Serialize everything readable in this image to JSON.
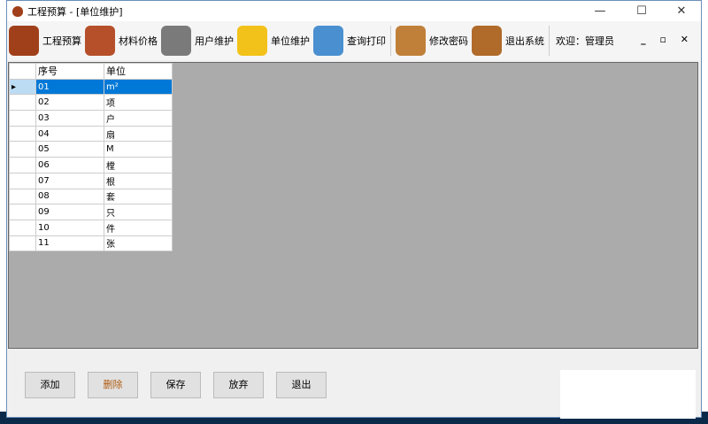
{
  "window": {
    "title": "工程预算 - [单位维护]",
    "minimize": "—",
    "maximize": "☐",
    "close": "✕"
  },
  "toolbar": {
    "items": [
      {
        "label": "工程预算",
        "icon": "money-bag-icon",
        "color": "#a0401a"
      },
      {
        "label": "材料价格",
        "icon": "box-icon",
        "color": "#b5502a"
      },
      {
        "label": "用户维护",
        "icon": "user-icon",
        "color": "#7a7a7a"
      },
      {
        "label": "单位维护",
        "icon": "ruler-icon",
        "color": "#f2c21a"
      },
      {
        "label": "查询打印",
        "icon": "report-icon",
        "color": "#4a90d0"
      },
      {
        "label": "修改密码",
        "icon": "user-lock-icon",
        "color": "#c0803a"
      },
      {
        "label": "退出系统",
        "icon": "exit-door-icon",
        "color": "#b06a2a"
      }
    ],
    "welcome": "欢迎：管理员",
    "mdi_controls": "_ ▫ ✕"
  },
  "grid": {
    "columns": [
      "序号",
      "单位"
    ],
    "rows": [
      [
        "01",
        "m²"
      ],
      [
        "02",
        "项"
      ],
      [
        "03",
        "户"
      ],
      [
        "04",
        "扇"
      ],
      [
        "05",
        "M"
      ],
      [
        "06",
        "樘"
      ],
      [
        "07",
        "根"
      ],
      [
        "08",
        "套"
      ],
      [
        "09",
        "只"
      ],
      [
        "10",
        "件"
      ],
      [
        "11",
        "张"
      ]
    ],
    "selected_row": 0
  },
  "buttons": {
    "add": "添加",
    "delete": "删除",
    "save": "保存",
    "discard": "放弃",
    "exit": "退出"
  }
}
